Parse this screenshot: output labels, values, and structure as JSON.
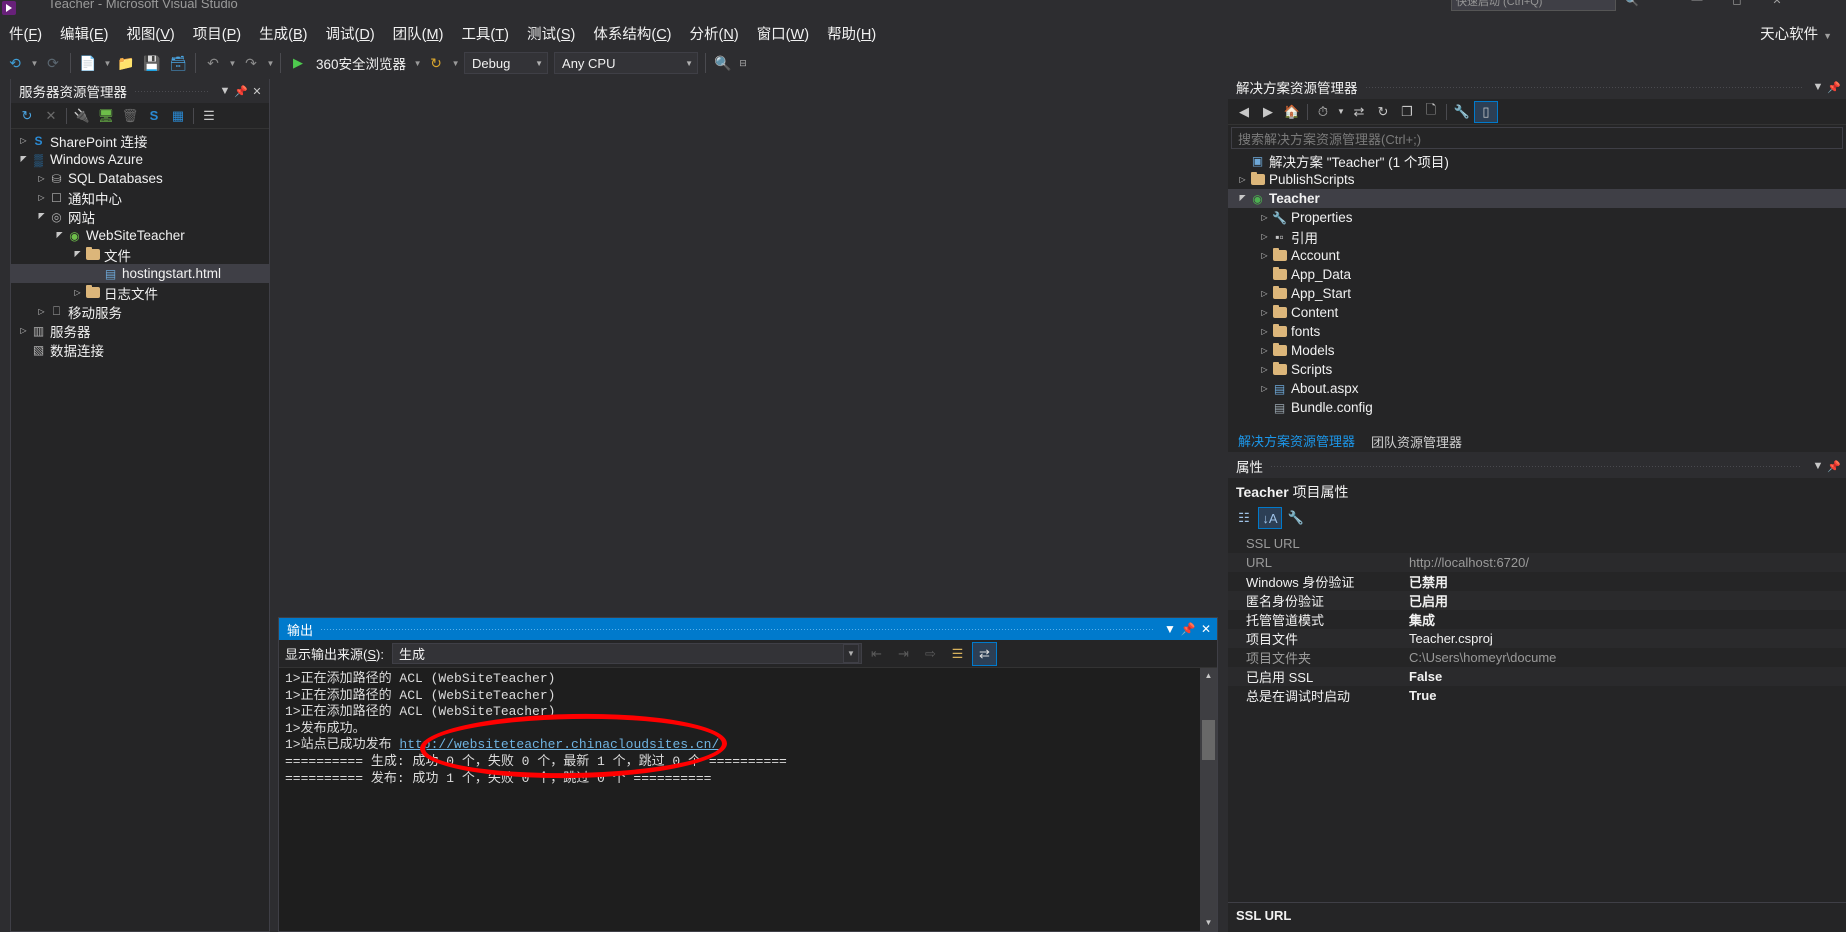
{
  "window": {
    "title": "Teacher - Microsoft Visual Studio",
    "account": "天心软件",
    "quick_launch_placeholder": "快速启动 (Ctrl+Q)"
  },
  "menu": [
    {
      "label": "件(",
      "key": "F",
      "suffix": ")"
    },
    {
      "label": "编辑(",
      "key": "E",
      "suffix": ")"
    },
    {
      "label": "视图(",
      "key": "V",
      "suffix": ")"
    },
    {
      "label": "项目(",
      "key": "P",
      "suffix": ")"
    },
    {
      "label": "生成(",
      "key": "B",
      "suffix": ")"
    },
    {
      "label": "调试(",
      "key": "D",
      "suffix": ")"
    },
    {
      "label": "团队(",
      "key": "M",
      "suffix": ")"
    },
    {
      "label": "工具(",
      "key": "T",
      "suffix": ")"
    },
    {
      "label": "测试(",
      "key": "S",
      "suffix": ")"
    },
    {
      "label": "体系结构(",
      "key": "C",
      "suffix": ")"
    },
    {
      "label": "分析(",
      "key": "N",
      "suffix": ")"
    },
    {
      "label": "窗口(",
      "key": "W",
      "suffix": ")"
    },
    {
      "label": "帮助(",
      "key": "H",
      "suffix": ")"
    }
  ],
  "toolbar": {
    "start_label": "360安全浏览器",
    "config_value": "Debug",
    "platform_value": "Any CPU",
    "icons": [
      "new-project-icon",
      "open-file-icon",
      "save-icon",
      "save-all-icon",
      "undo-icon",
      "redo-icon",
      "start-debug-icon",
      "refresh-icon",
      "find-in-files-icon"
    ]
  },
  "server_explorer": {
    "title": "服务器资源管理器",
    "toolbar_icons": [
      "refresh-icon",
      "stop-icon",
      "connect-database-icon",
      "add-server-icon",
      "delete-icon",
      "sharepoint-icon",
      "azure-icon",
      "object-browser-icon"
    ],
    "tree": [
      {
        "label": "SharePoint 连接",
        "depth": 0,
        "expander": "collapsed",
        "icon": "sharepoint-icon",
        "selected": false
      },
      {
        "label": "Windows Azure",
        "depth": 0,
        "expander": "expanded",
        "icon": "azure-icon",
        "selected": false
      },
      {
        "label": "SQL Databases",
        "depth": 1,
        "expander": "collapsed",
        "icon": "database-icon",
        "selected": false
      },
      {
        "label": "通知中心",
        "depth": 1,
        "expander": "collapsed",
        "icon": "notification-icon",
        "selected": false
      },
      {
        "label": "网站",
        "depth": 1,
        "expander": "expanded",
        "icon": "website-icon",
        "selected": false
      },
      {
        "label": "WebSiteTeacher",
        "depth": 2,
        "expander": "expanded",
        "icon": "website-running-icon",
        "selected": false
      },
      {
        "label": "文件",
        "depth": 3,
        "expander": "expanded",
        "icon": "web-folder-icon",
        "selected": false
      },
      {
        "label": "hostingstart.html",
        "depth": 4,
        "expander": "none",
        "icon": "html-file-icon",
        "selected": true
      },
      {
        "label": "日志文件",
        "depth": 3,
        "expander": "collapsed",
        "icon": "log-folder-icon",
        "selected": false
      },
      {
        "label": "移动服务",
        "depth": 1,
        "expander": "collapsed",
        "icon": "mobile-service-icon",
        "selected": false
      },
      {
        "label": "服务器",
        "depth": 0,
        "expander": "collapsed",
        "icon": "server-icon",
        "selected": false
      },
      {
        "label": "数据连接",
        "depth": 0,
        "expander": "none",
        "icon": "data-connection-icon",
        "selected": false
      }
    ]
  },
  "solution_explorer": {
    "title": "解决方案资源管理器",
    "search_placeholder": "搜索解决方案资源管理器(Ctrl+;)",
    "toolbar_icons": [
      "back-icon",
      "forward-icon",
      "home-icon",
      "pending-changes-icon",
      "sync-icon",
      "refresh-icon",
      "collapse-all-icon",
      "show-all-files-icon",
      "properties-icon",
      "preview-selected-items-icon"
    ],
    "tree": [
      {
        "label": "解决方案 \"Teacher\" (1 个项目)",
        "depth": 0,
        "expander": "none",
        "icon": "solution-icon",
        "bold": false,
        "selected": false
      },
      {
        "label": "PublishScripts",
        "depth": 0,
        "expander": "collapsed",
        "icon": "folder-icon",
        "bold": false,
        "selected": false
      },
      {
        "label": "Teacher",
        "depth": 0,
        "expander": "expanded",
        "icon": "web-project-icon",
        "bold": true,
        "selected": true
      },
      {
        "label": "Properties",
        "depth": 1,
        "expander": "collapsed",
        "icon": "wrench-icon",
        "bold": false,
        "selected": false
      },
      {
        "label": "引用",
        "depth": 1,
        "expander": "collapsed",
        "icon": "references-icon",
        "bold": false,
        "selected": false
      },
      {
        "label": "Account",
        "depth": 1,
        "expander": "collapsed",
        "icon": "folder-icon",
        "bold": false,
        "selected": false
      },
      {
        "label": "App_Data",
        "depth": 1,
        "expander": "none",
        "icon": "folder-icon",
        "bold": false,
        "selected": false
      },
      {
        "label": "App_Start",
        "depth": 1,
        "expander": "collapsed",
        "icon": "folder-icon",
        "bold": false,
        "selected": false
      },
      {
        "label": "Content",
        "depth": 1,
        "expander": "collapsed",
        "icon": "folder-icon",
        "bold": false,
        "selected": false
      },
      {
        "label": "fonts",
        "depth": 1,
        "expander": "collapsed",
        "icon": "folder-icon",
        "bold": false,
        "selected": false
      },
      {
        "label": "Models",
        "depth": 1,
        "expander": "collapsed",
        "icon": "folder-icon",
        "bold": false,
        "selected": false
      },
      {
        "label": "Scripts",
        "depth": 1,
        "expander": "collapsed",
        "icon": "folder-icon",
        "bold": false,
        "selected": false
      },
      {
        "label": "About.aspx",
        "depth": 1,
        "expander": "collapsed",
        "icon": "aspx-file-icon",
        "bold": false,
        "selected": false
      },
      {
        "label": "Bundle.config",
        "depth": 1,
        "expander": "none",
        "icon": "config-file-icon",
        "bold": false,
        "selected": false
      }
    ],
    "tabs": [
      {
        "label": "解决方案资源管理器",
        "active": true
      },
      {
        "label": "团队资源管理器",
        "active": false
      }
    ]
  },
  "properties": {
    "title": "属性",
    "object_name": "Teacher",
    "object_kind": "项目属性",
    "toolbar_icons": [
      "categorized-icon",
      "alphabetical-icon",
      "property-pages-icon"
    ],
    "rows": [
      {
        "key": "SSL URL",
        "value": "",
        "dim": true,
        "bold": false
      },
      {
        "key": "URL",
        "value": "http://localhost:6720/",
        "dim": true,
        "bold": false
      },
      {
        "key": "Windows 身份验证",
        "value": "已禁用",
        "dim": false,
        "bold": true
      },
      {
        "key": "匿名身份验证",
        "value": "已启用",
        "dim": false,
        "bold": true
      },
      {
        "key": "托管管道模式",
        "value": "集成",
        "dim": false,
        "bold": true
      },
      {
        "key": "项目文件",
        "value": "Teacher.csproj",
        "dim": false,
        "bold": false
      },
      {
        "key": "项目文件夹",
        "value": "C:\\Users\\homeyr\\docume",
        "dim": true,
        "bold": false
      },
      {
        "key": "已启用 SSL",
        "value": "False",
        "dim": false,
        "bold": true
      },
      {
        "key": "总是在调试时启动",
        "value": "True",
        "dim": false,
        "bold": true
      }
    ],
    "description_title": "SSL URL"
  },
  "output": {
    "title": "输出",
    "source_label_prefix": "显示输出来源(",
    "source_label_key": "S",
    "source_label_suffix": "):",
    "source_value": "生成",
    "toolbar_icons": [
      "goto-previous-message-icon",
      "goto-next-message-icon",
      "goto-message-icon",
      "clear-all-icon",
      "toggle-word-wrap-icon"
    ],
    "lines": [
      {
        "text": "1>正在添加路径的 ACL (WebSiteTeacher)",
        "link": null
      },
      {
        "text": "1>正在添加路径的 ACL (WebSiteTeacher)",
        "link": null
      },
      {
        "text": "1>正在添加路径的 ACL (WebSiteTeacher)",
        "link": null
      },
      {
        "text": "1>发布成功。",
        "link": null
      },
      {
        "text": "1>站点已成功发布 ",
        "link": "http://websiteteacher.chinacloudsites.cn/"
      },
      {
        "text": "========== 生成: 成功 0 个，失败 0 个，最新 1 个，跳过 0 个 ==========",
        "link": null
      },
      {
        "text": "========== 发布: 成功 1 个，失败 0 个，跳过 0 个 ==========",
        "link": null
      }
    ]
  },
  "annotation": {
    "shape": "ellipse",
    "color": "#ff0000",
    "target": "http://websiteteacher.chinacloudsites.cn/"
  }
}
